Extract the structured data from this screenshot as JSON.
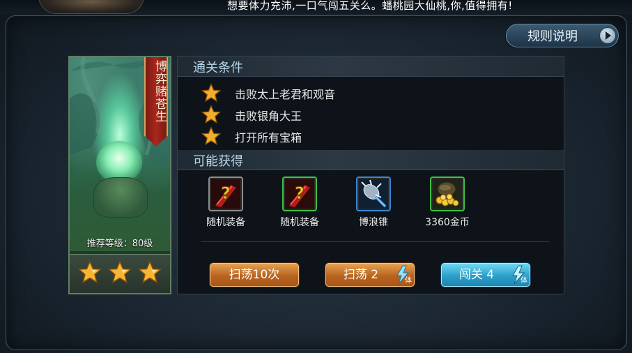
{
  "top_banner": {
    "message": "想要体力充沛,一口气闯五关么。蟠桃园大仙桃,你,值得拥有!"
  },
  "rules_button": {
    "label": "规则说明"
  },
  "stage_card": {
    "banner_title": "博弈赌苍生",
    "recommended_level": "推荐等级：80级",
    "stars_earned": 3,
    "stars_total": 3
  },
  "clear_conditions": {
    "title": "通关条件",
    "items": [
      {
        "text": "击败太上老君和观音"
      },
      {
        "text": "击败银角大王"
      },
      {
        "text": "打开所有宝箱"
      }
    ]
  },
  "possible_rewards": {
    "title": "可能获得",
    "items": [
      {
        "name": "随机装备",
        "icon": "random-equipment-icon",
        "border": "#8c8c8c"
      },
      {
        "name": "随机装备",
        "icon": "random-equipment-icon",
        "border": "#3fbf4a"
      },
      {
        "name": "博浪锥",
        "icon": "spiked-mace-icon",
        "border": "#3a86d6"
      },
      {
        "name": "3360金币",
        "icon": "gold-coins-icon",
        "border": "#3fbf4a"
      }
    ]
  },
  "actions": {
    "sweep10_label": "扫荡10次",
    "sweep_label": "扫荡 2",
    "challenge_label": "闯关 4",
    "energy_label": "体"
  },
  "colors": {
    "accent_orange": "#c9742a",
    "accent_blue": "#2ba6d2",
    "header_text": "#b9d8ec"
  }
}
